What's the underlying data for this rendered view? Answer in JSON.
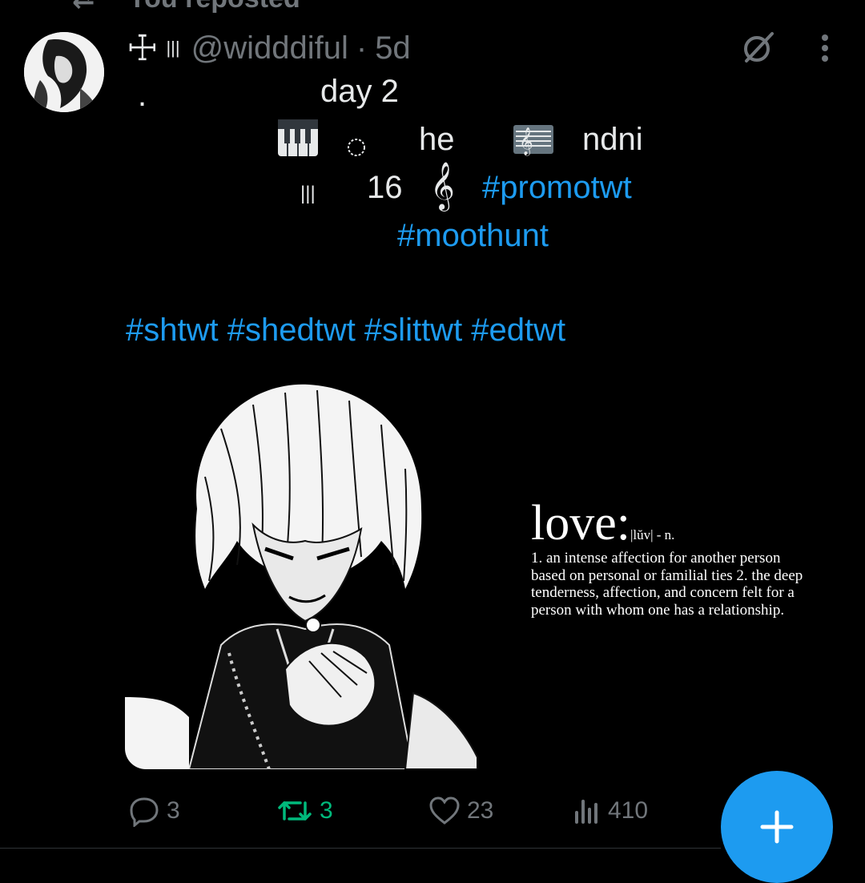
{
  "repost_banner": {
    "text": "You reposted"
  },
  "post": {
    "handle": "@widddiful",
    "separator": "·",
    "time": "5d",
    "lines": {
      "dot": ".",
      "day": "day 2",
      "line2_he": "he",
      "line2_ndni": "ndni",
      "line3_age": "16",
      "tag_promotwt": "#promotwt",
      "tag_moothunt": "#moothunt",
      "tags_row": "#shtwt #shedtwt #slittwt #edtwt"
    },
    "media_text": {
      "word": "love:",
      "pronunciation": "|lŭv| - n.",
      "definition": "1. an intense affection for another person based on personal or familial ties 2. the deep tenderness, affection, and concern felt for a person with whom one has a relationship."
    }
  },
  "actions": {
    "replies": "3",
    "reposts": "3",
    "likes": "23",
    "views": "410"
  },
  "icons": {
    "avatar": "avatar-image",
    "cross": "cross-icon",
    "grok": "grok-icon",
    "more": "more-options-icon",
    "piano": "piano-emoji-icon",
    "circle": "dotted-circle-icon",
    "score": "musical-score-emoji-icon",
    "treble": "treble-clef-icon",
    "reply": "reply-icon",
    "retweet": "retweet-icon",
    "like": "heart-icon",
    "views": "views-icon",
    "compose": "plus-icon"
  },
  "colors": {
    "background": "#000000",
    "text": "#e7e9ea",
    "muted": "#71767b",
    "accent": "#1d9bf0",
    "retweet_active": "#00ba7c"
  }
}
